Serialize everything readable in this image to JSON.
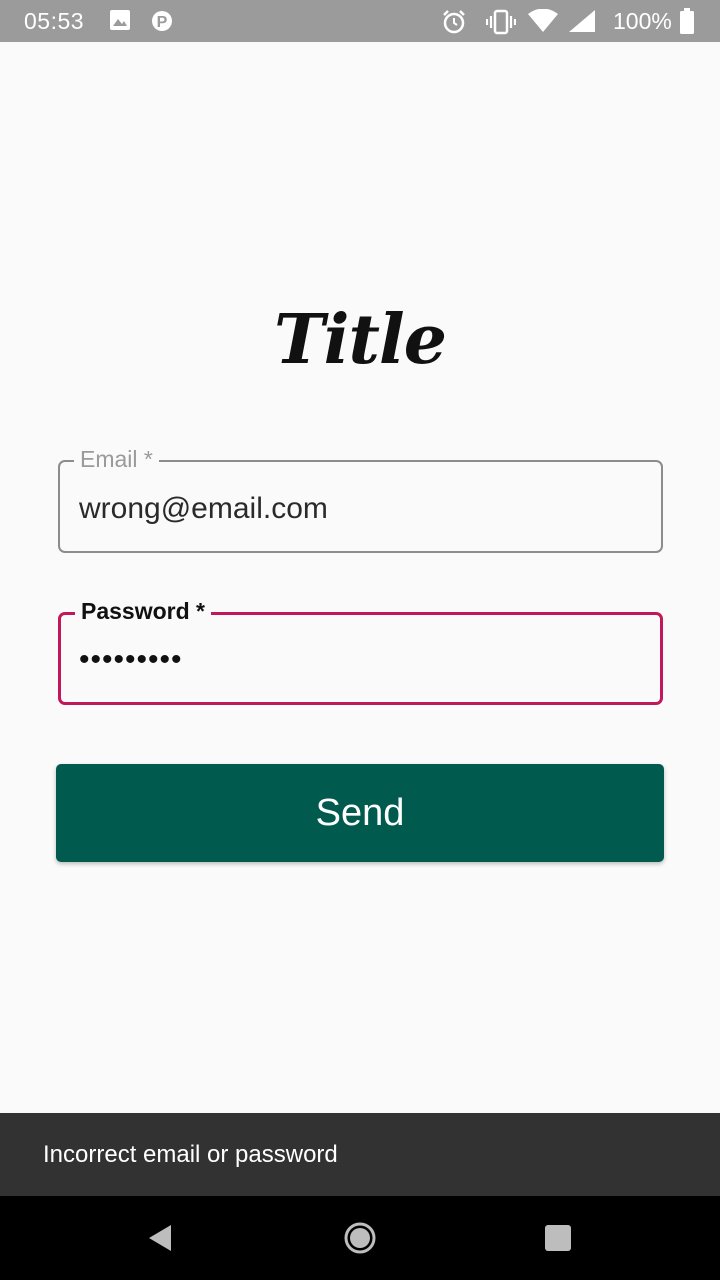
{
  "status_bar": {
    "time": "05:53",
    "battery": "100%",
    "icons": [
      "image-icon",
      "parking-icon",
      "alarm-icon",
      "vibrate-icon",
      "wifi-icon",
      "signal-icon",
      "battery-icon"
    ]
  },
  "app": {
    "title": "Title"
  },
  "form": {
    "email": {
      "label": "Email *",
      "value": "wrong@email.com"
    },
    "password": {
      "label": "Password *",
      "value": "•••••••••"
    },
    "send_label": "Send"
  },
  "snackbar": {
    "message": "Incorrect email or password"
  },
  "nav_bar": {
    "icons": [
      "back-icon",
      "home-icon",
      "recents-icon"
    ]
  },
  "colors": {
    "status_bar": "#9b9b9b",
    "background": "#fafafa",
    "button": "#005a4d",
    "error_border": "#c2185b",
    "snackbar": "#323232"
  }
}
